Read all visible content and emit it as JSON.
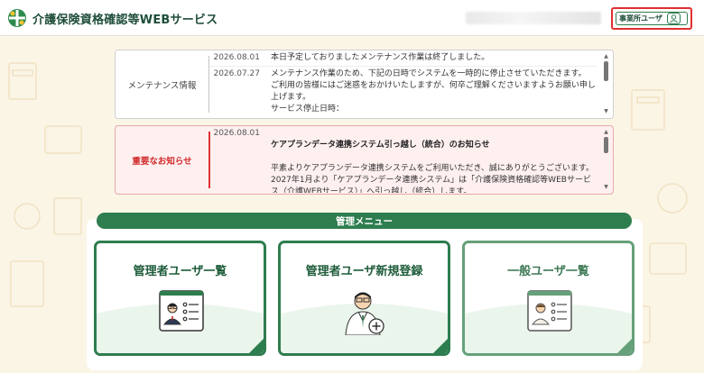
{
  "header": {
    "app_title": "介護保険資格確認等WEBサービス",
    "user_badge_label": "事業所ユーザ"
  },
  "notices": {
    "maintenance": {
      "label": "メンテナンス情報",
      "items": [
        {
          "date": "2026.08.01",
          "text": "本日予定しておりましたメンテナンス作業は終了しました。"
        },
        {
          "date": "2026.07.27",
          "text": "メンテナンス作業のため、下記の日時でシステムを一時的に停止させていただきます。\nご利用の皆様にはご迷惑をおかけいたしますが、何卒ご理解くださいますようお願い申し上げます。\nサービス停止日時："
        }
      ]
    },
    "important": {
      "label": "重要なお知らせ",
      "items": [
        {
          "date": "2026.08.01",
          "title": "ケアプランデータ連携システム引っ越し（統合）のお知らせ",
          "text": "平素よりケアプランデータ連携システムをご利用いただき、誠にありがとうございます。\n2027年1月より「ケアプランデータ連携システム」は「介護保険資格確認等WEBサービス（介護WEBサービス）」へ引っ越し（統合）します。"
        }
      ]
    }
  },
  "menu": {
    "header": "管理メニュー",
    "cards": [
      {
        "label": "管理者ユーザ一覧",
        "icon": "admin-user-list-icon"
      },
      {
        "label": "管理者ユーザ新規登録",
        "icon": "admin-user-register-icon"
      },
      {
        "label": "一般ユーザ一覧",
        "icon": "general-user-list-icon"
      }
    ]
  },
  "colors": {
    "brand_green": "#2e7d4f",
    "important_red": "#d12a2a",
    "background": "#fbf5e6"
  }
}
